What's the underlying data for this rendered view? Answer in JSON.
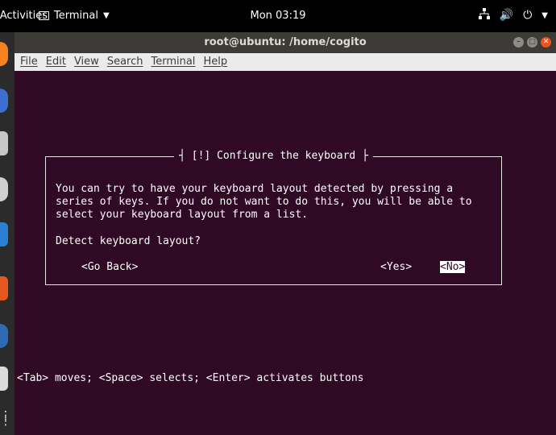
{
  "topbar": {
    "activities": "Activities",
    "app_name": "Terminal",
    "clock": "Mon 03:19"
  },
  "window": {
    "title": "root@ubuntu: /home/cogito",
    "menu": [
      "File",
      "Edit",
      "View",
      "Search",
      "Terminal",
      "Help"
    ]
  },
  "dialog": {
    "title": "[!] Configure the keyboard",
    "body": "You can try to have your keyboard layout detected by pressing a\nseries of keys. If you do not want to do this, you will be able to\nselect your keyboard layout from a list.",
    "question": "Detect keyboard layout?",
    "buttons": {
      "back": "<Go Back>",
      "yes": "<Yes>",
      "no_first": "<N",
      "no_rest": "o>"
    }
  },
  "help_line": "<Tab> moves; <Space> selects; <Enter> activates buttons",
  "colors": {
    "terminal_bg": "#300a24",
    "close_button": "#e95420"
  },
  "icons": [
    "terminal-icon",
    "network-icon",
    "volume-icon",
    "power-icon"
  ]
}
